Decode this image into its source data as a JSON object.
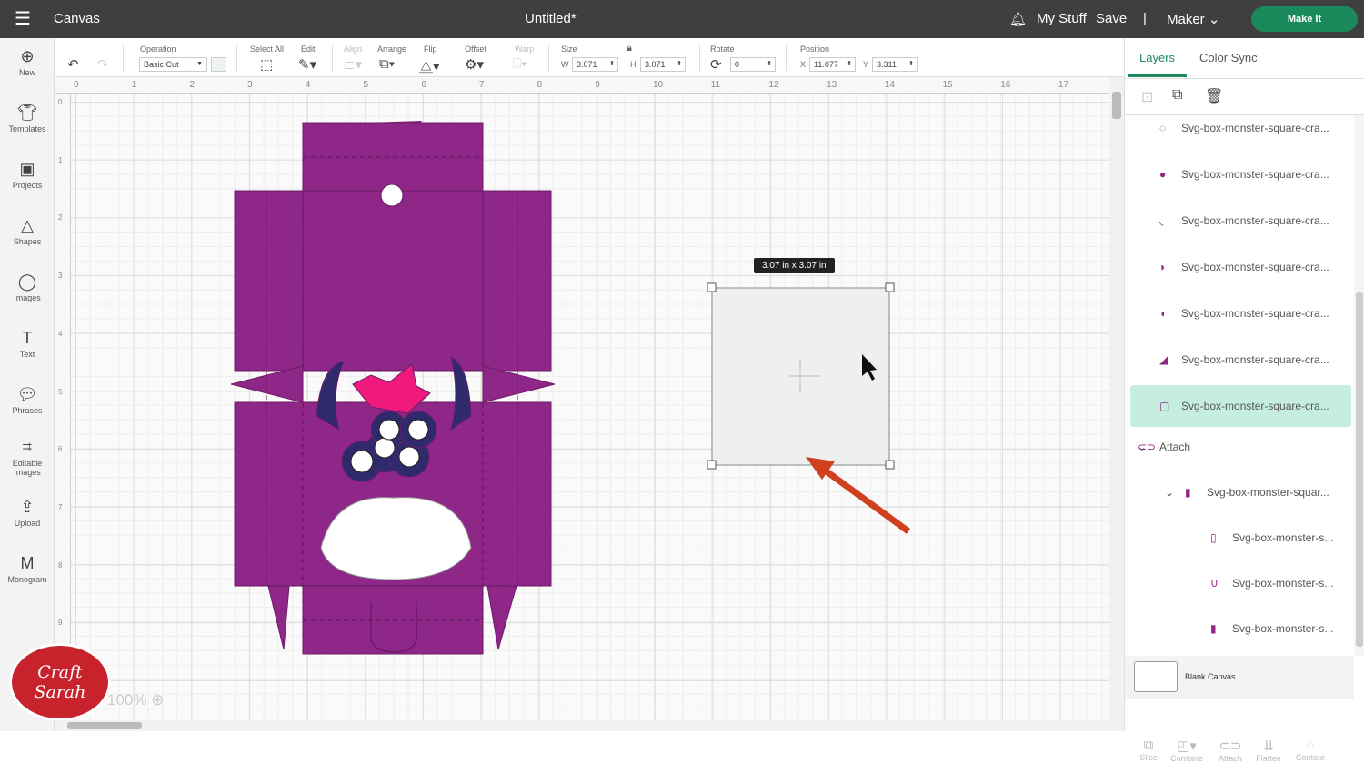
{
  "topbar": {
    "menu_icon": "hamburger-icon",
    "title": "Canvas",
    "doc_title": "Untitled*",
    "my_stuff": "My Stuff",
    "save": "Save",
    "machine": "Maker",
    "make_it": "Make It"
  },
  "sidebar": [
    {
      "label": "New",
      "icon": "plus-circle-icon"
    },
    {
      "label": "Templates",
      "icon": "shirt-icon"
    },
    {
      "label": "Projects",
      "icon": "projects-icon"
    },
    {
      "label": "Shapes",
      "icon": "shapes-icon"
    },
    {
      "label": "Images",
      "icon": "lightbulb-icon"
    },
    {
      "label": "Text",
      "icon": "text-icon"
    },
    {
      "label": "Phrases",
      "icon": "speech-icon"
    },
    {
      "label": "Editable Images",
      "icon": "editable-image-icon"
    },
    {
      "label": "Upload",
      "icon": "upload-icon"
    },
    {
      "label": "Monogram",
      "icon": "monogram-icon"
    }
  ],
  "toolbar": {
    "operation_label": "Operation",
    "operation_value": "Basic Cut",
    "select_all": "Select All",
    "edit": "Edit",
    "align": "Align",
    "arrange": "Arrange",
    "flip": "Flip",
    "offset": "Offset",
    "warp": "Warp",
    "size": "Size",
    "w_label": "W",
    "w_value": "3.071",
    "h_label": "H",
    "h_value": "3.071",
    "rotate": "Rotate",
    "rotate_value": "0",
    "position": "Position",
    "x_label": "X",
    "x_value": "11.077",
    "y_label": "Y",
    "y_value": "3.311"
  },
  "ruler_h": [
    "0",
    "1",
    "2",
    "3",
    "4",
    "5",
    "6",
    "7",
    "8",
    "9",
    "10",
    "11",
    "12",
    "13",
    "14",
    "15",
    "16",
    "17"
  ],
  "ruler_v": [
    "0",
    "1",
    "2",
    "3",
    "4",
    "5",
    "6",
    "7",
    "8",
    "9"
  ],
  "canvas": {
    "size_tooltip": "3.07  in x 3.07  in",
    "zoom": "100%",
    "watermark": "Craft with Sarah",
    "colors": {
      "box": "#8e2788",
      "pink": "#f0197d",
      "navy": "#2e2a6b",
      "shape": "#edf0ef",
      "arrow": "#d0401f"
    }
  },
  "panel": {
    "tabs": [
      "Layers",
      "Color Sync"
    ],
    "layers": [
      "Svg-box-monster-square-cra...",
      "Svg-box-monster-square-cra...",
      "Svg-box-monster-square-cra...",
      "Svg-box-monster-square-cra...",
      "Svg-box-monster-square-cra...",
      "Svg-box-monster-square-cra...",
      "Svg-box-monster-square-cra..."
    ],
    "attach": "Attach",
    "group": "Svg-box-monster-squar...",
    "children": [
      "Svg-box-monster-s...",
      "Svg-box-monster-s...",
      "Svg-box-monster-s..."
    ],
    "blank_canvas": "Blank Canvas",
    "bottom": [
      "Slice",
      "Combine",
      "Attach",
      "Flatten",
      "Contour"
    ]
  }
}
